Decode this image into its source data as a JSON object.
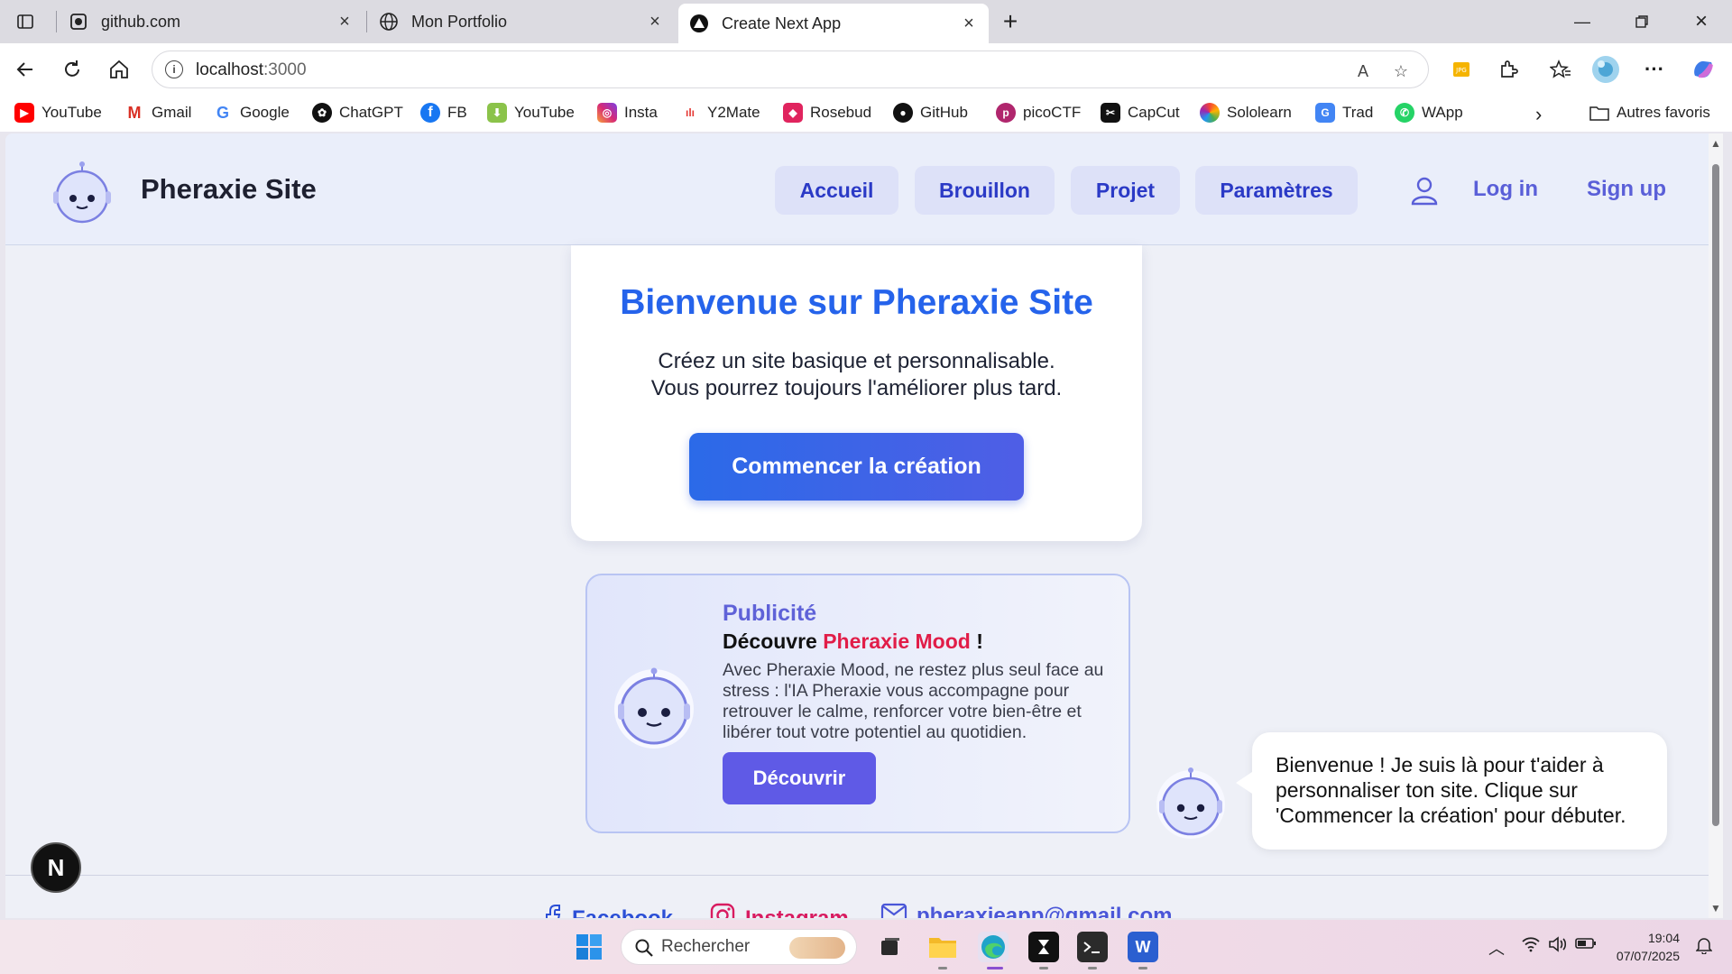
{
  "browser": {
    "tabs": [
      {
        "title": "github.com",
        "icon": "github-icon"
      },
      {
        "title": "Mon Portfolio",
        "icon": "globe-icon"
      },
      {
        "title": "Create Next App",
        "icon": "nextjs-icon",
        "active": true
      }
    ],
    "url_host": "localhost",
    "url_port": ":3000",
    "bookmarks": [
      "YouTube",
      "Gmail",
      "Google",
      "ChatGPT",
      "FB",
      "YouTube",
      "Insta",
      "Y2Mate",
      "Rosebud",
      "GitHub",
      "picoCTF",
      "CapCut",
      "Sololearn",
      "Trad",
      "WApp"
    ],
    "other_bookmarks": "Autres favoris"
  },
  "site": {
    "title": "Pheraxie Site",
    "nav": [
      "Accueil",
      "Brouillon",
      "Projet",
      "Paramètres"
    ],
    "login": "Log in",
    "signup": "Sign up",
    "accent": "#2563eb"
  },
  "hero": {
    "title": "Bienvenue sur Pheraxie Site",
    "line1": "Créez un site basique et personnalisable.",
    "line2": "Vous pourrez toujours l'améliorer plus tard.",
    "cta": "Commencer la création"
  },
  "ad": {
    "label": "Publicité",
    "title_prefix": "Découvre ",
    "title_brand": "Pheraxie Mood",
    "title_suffix": " !",
    "text": "Avec Pheraxie Mood, ne restez plus seul face au stress : l'IA Pheraxie vous accompagne pour retrouver le calme, renforcer votre bien-être et libérer tout votre potentiel au quotidien.",
    "button": "Découvrir"
  },
  "assistant": {
    "message": "Bienvenue ! Je suis là pour t'aider à personnaliser ton site. Clique sur 'Commencer la création' pour débuter."
  },
  "footer": {
    "facebook": "Facebook",
    "instagram": "Instagram",
    "email": "pheraxieapp@gmail.com"
  },
  "dev_badge": "N",
  "taskbar": {
    "search_placeholder": "Rechercher",
    "time": "19:04",
    "date": "07/07/2025"
  }
}
